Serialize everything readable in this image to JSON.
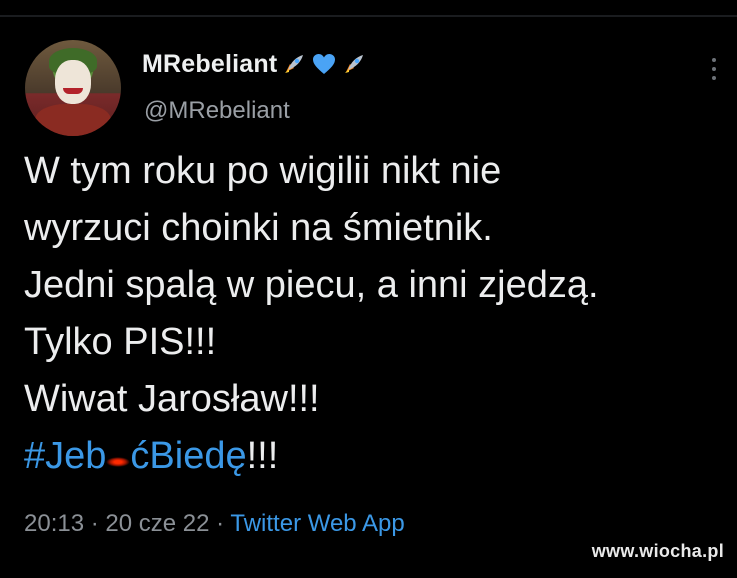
{
  "tweet": {
    "author_name": "MRebeliant",
    "author_emojis": [
      "rocket-icon",
      "blue-heart-icon",
      "rocket-icon"
    ],
    "handle": "@MRebeliant",
    "lines": [
      "W tym roku po wigilii nikt nie",
      "wyrzuci choinki na śmietnik.",
      "Jedni spalą w piecu, a inni zjedzą.",
      "Tylko PIS!!!",
      "Wiwat Jarosław!!!"
    ],
    "hashtag_start": "#Jeb",
    "hashtag_end": "ćBiedę",
    "hashtag_suffix": "!!!",
    "time": "20:13",
    "date": "20 cze 22",
    "separator": "·",
    "app": "Twitter Web App"
  },
  "watermark": "www.wiocha.pl",
  "colors": {
    "background": "#000000",
    "text": "#e7e9ea",
    "muted": "#8b9096",
    "link": "#3b98e6"
  }
}
